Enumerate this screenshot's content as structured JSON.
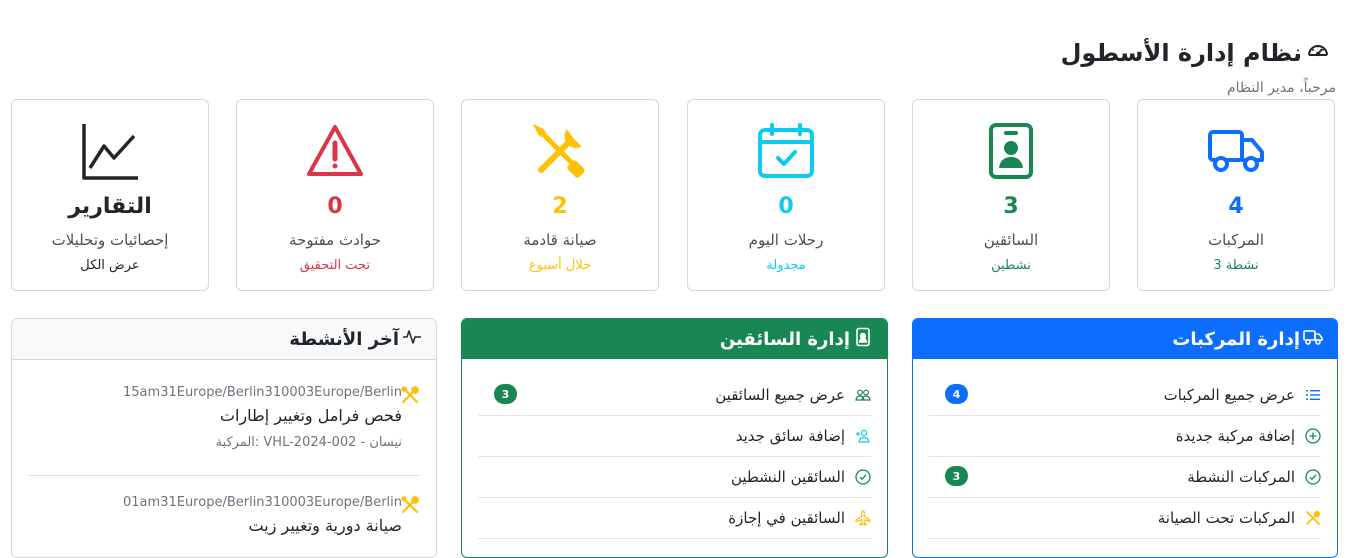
{
  "header": {
    "title": "نظام إدارة الأسطول",
    "subtitle": "مرحباً، مدير النظام"
  },
  "cards": [
    {
      "id": "vehicles",
      "value": "4",
      "label": "المركبات",
      "sub": "3 نشطة",
      "color": "#0d6efd",
      "subcolor": "#198754",
      "icon": "truck-icon"
    },
    {
      "id": "drivers",
      "value": "3",
      "label": "السائقين",
      "sub": "نشطين",
      "color": "#198754",
      "subcolor": "#198754",
      "icon": "badge-person-icon"
    },
    {
      "id": "trips",
      "value": "0",
      "label": "رحلات اليوم",
      "sub": "مجدولة",
      "color": "#0dcaf0",
      "subcolor": "#0dcaf0",
      "icon": "calendar-check-icon"
    },
    {
      "id": "maintenance",
      "value": "2",
      "label": "صيانة قادمة",
      "sub": "خلال أسبوع",
      "color": "#ffc107",
      "subcolor": "#ffc107",
      "icon": "tools-icon"
    },
    {
      "id": "accidents",
      "value": "0",
      "label": "حوادث مفتوحة",
      "sub": "تحت التحقيق",
      "color": "#dc3545",
      "subcolor": "#dc3545",
      "icon": "warning-icon"
    },
    {
      "id": "reports",
      "value": "التقارير",
      "label": "إحصائيات وتحليلات",
      "sub": "عرض الكل",
      "color": "#212529",
      "subcolor": "#212529",
      "icon": "chart-line-icon"
    }
  ],
  "vehicles_panel": {
    "title": "إدارة المركبات",
    "color": "#0d6efd",
    "items": [
      {
        "label": "عرض جميع المركبات",
        "badge": "4",
        "icon": "list-icon"
      },
      {
        "label": "إضافة مركبة جديدة",
        "badge": "",
        "icon": "plus-circle-icon"
      },
      {
        "label": "المركبات النشطة",
        "badge": "3",
        "icon": "check-circle-icon"
      },
      {
        "label": "المركبات تحت الصيانة",
        "badge": "",
        "icon": "tools-icon"
      }
    ]
  },
  "drivers_panel": {
    "title": "إدارة السائقين",
    "color": "#198754",
    "items": [
      {
        "label": "عرض جميع السائقين",
        "badge": "3",
        "icon": "people-icon"
      },
      {
        "label": "إضافة سائق جديد",
        "badge": "",
        "icon": "person-plus-icon"
      },
      {
        "label": "السائقين النشطين",
        "badge": "",
        "icon": "check-circle-icon"
      },
      {
        "label": "السائقين في إجازة",
        "badge": "",
        "icon": "airplane-icon"
      }
    ]
  },
  "activity_panel": {
    "title": "آخر الأنشطة",
    "items": [
      {
        "time": "15am31Europe/Berlin310003Europe/Berlin",
        "title": "فحص فرامل وتغيير إطارات",
        "meta": "المركبة: VHL-2024-002 - نيسان"
      },
      {
        "time": "01am31Europe/Berlin310003Europe/Berlin",
        "title": "صيانة دورية وتغيير زيت",
        "meta": ""
      }
    ]
  }
}
